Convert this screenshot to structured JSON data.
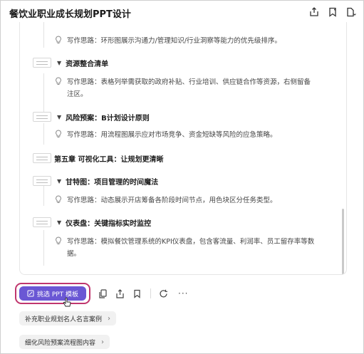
{
  "title": "餐饮业职业成长规划PPT设计",
  "header_icons": [
    "share-icon",
    "bookmark-icon",
    "document-menu-icon"
  ],
  "hint_prefix": "写作思路：",
  "outline": [
    {
      "hint": "环形图展示沟通力/管理知识/行业洞察等能力的优先级排序。"
    },
    {
      "section": "资源整合清单",
      "hint_line1": "表格列举需获取的政府补贴、行业培训、供应链合作等资源，右侧留备",
      "hint_line2": "注区。"
    },
    {
      "section": "风险预案：B计划设计原则",
      "hint": "用流程图展示应对市场竞争、资金短缺等风险的应急策略。"
    },
    {
      "chapter": "第五章 可视化工具：让规划更清晰"
    },
    {
      "section": "甘特图：项目管理的时间魔法",
      "hint": "动态展示开店筹备各阶段时间节点，用色块区分任务类型。"
    },
    {
      "section": "仪表盘：关键指标实时监控",
      "hint_line1": "模拟餐饮管理系统的KPI仪表盘，包含客流量、利润率、员工留存率等数",
      "hint_line2": "据。"
    }
  ],
  "actions": {
    "ppt_button": "挑选 PPT 模板",
    "more": "···"
  },
  "suggestions": [
    {
      "label": "补充职业规划名人名言案例"
    },
    {
      "label": "细化风险预案流程图内容"
    }
  ],
  "colors": {
    "primary": "#6a57d4",
    "highlight": "#c0366e"
  }
}
